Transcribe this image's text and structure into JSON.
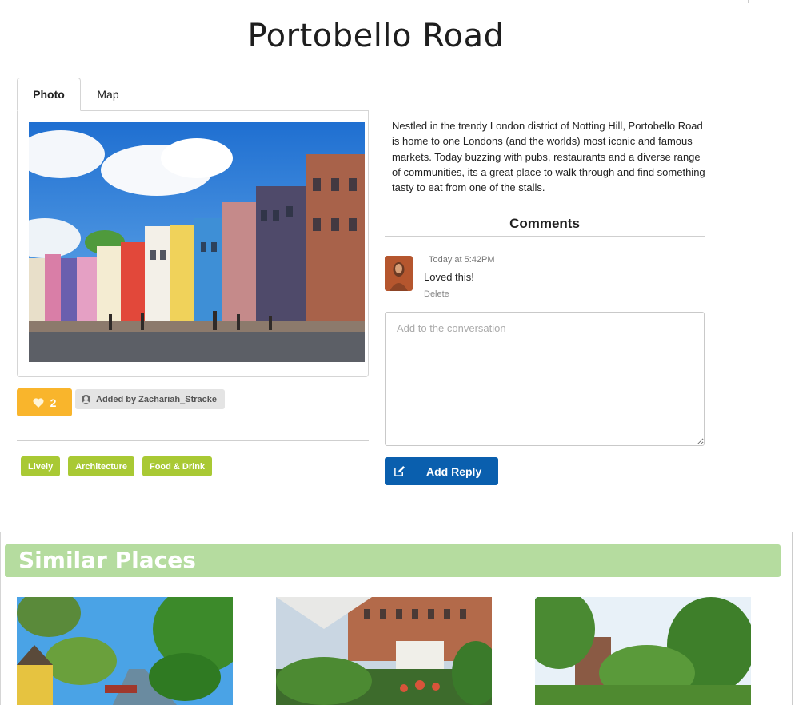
{
  "page": {
    "title": "Portobello Road"
  },
  "tabs": [
    {
      "label": "Photo",
      "active": true
    },
    {
      "label": "Map",
      "active": false
    }
  ],
  "photo": {
    "icon": "street-photo"
  },
  "like": {
    "count": "2",
    "icon": "heart-icon",
    "color": "#f9b52c"
  },
  "author": {
    "label": "Added by Zachariah_Stracke",
    "icon": "user-icon"
  },
  "tags": [
    {
      "label": "Lively"
    },
    {
      "label": "Architecture"
    },
    {
      "label": "Food & Drink"
    }
  ],
  "tag_color": "#a9c934",
  "description": "Nestled in the trendy London district of Notting Hill, Portobello Road is home to one Londons (and the worlds) most iconic and famous markets. Today buzzing with pubs, restaurants and a diverse range of communities, its a great place to walk through and find something tasty to eat from one of the stalls.",
  "comments": {
    "heading": "Comments",
    "items": [
      {
        "time": "Today at 5:42PM",
        "text": "Loved this!",
        "delete_label": "Delete"
      }
    ],
    "reply_placeholder": "Add to the conversation",
    "reply_button": "Add Reply",
    "reply_button_color": "#0a5fae"
  },
  "similar": {
    "title": "Similar Places",
    "header_color": "#b5dc9f",
    "places": [
      {
        "icon": "canal-photo"
      },
      {
        "icon": "market-photo"
      },
      {
        "icon": "park-photo"
      }
    ]
  }
}
